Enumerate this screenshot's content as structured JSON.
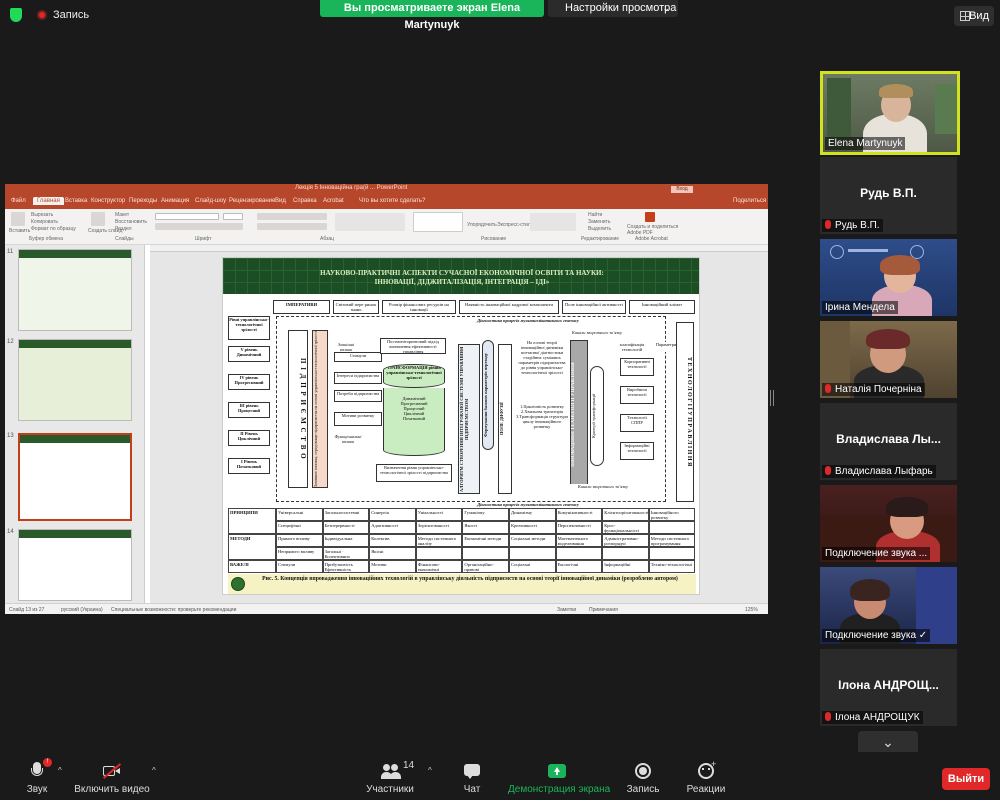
{
  "topbar": {
    "record_label": "Запись",
    "share_banner": "Вы просматриваете экран Elena Martynuyk",
    "view_settings": "Настройки просмотра",
    "view_button": "Вид"
  },
  "ppt": {
    "window_title": "Лекція 5 Інноваційна гра(й ... PowerPoint",
    "sign_in": "Вход",
    "tabs": [
      "Файл",
      "Главная",
      "Вставка",
      "Конструктор",
      "Переходы",
      "Анимация",
      "Слайд-шоу",
      "Рецензирование",
      "Вид",
      "Справка",
      "Acrobat"
    ],
    "tell_me": "Что вы хотите сделать?",
    "share": "Поделиться",
    "groups": [
      "Буфер обмена",
      "Слайды",
      "Шрифт",
      "Абзац",
      "Рисование",
      "Редактирование",
      "Adobe Acrobat"
    ],
    "ribbon_items": [
      "Вставить",
      "Вырезать",
      "Копировать",
      "Формат по образцу",
      "Создать слайд",
      "Макет",
      "Восстановить",
      "Раздел",
      "Упорядочить",
      "Экспресс-стили",
      "Найти",
      "Заменить",
      "Выделить",
      "Создать и поделиться Adobe PDF"
    ],
    "thumb_numbers": [
      "11",
      "12",
      "13",
      "14"
    ],
    "status": {
      "slide": "Слайд 13 из 27",
      "lang": "русский (Украина)",
      "accessibility": "Специальные возможности: проверьте рекомендации",
      "notes": "Заметки",
      "comments": "Примечания",
      "zoom": "125%"
    }
  },
  "slide": {
    "title_line1": "НАУКОВО-ПРАКТИЧНІ АСПЕКТИ СУЧАСНОЇ ЕКОНОМІЧНОЇ ОСВІТИ ТА НАУКИ:",
    "title_line2": "ІННОВАЦІЇ, ДІДЖИТАЛІЗАЦІЯ, ІНТЕГРАЦІЯ – ІДІ»",
    "imperatives": [
      "ІМПЕРАТИВИ",
      "Світовий пере ринок знань",
      "Розмір фінансових ресурсів на інновації",
      "Наявність інноваційної кадрової компоненти",
      "Поле інноваційної активності",
      "Інноваційний клімат"
    ],
    "levels": [
      "Рівні управлінсько-технологічної зрілості",
      "V рівень Динамічний",
      "IV рівень Прогресивний",
      "III рівень Процесний",
      "II Рівень Циклічний",
      "I Рівень Початковий"
    ],
    "enterprise": "П І Д П Р И Є М С Т В О",
    "environment_left": "Зовнішнє інновац. середовище підприємства на основі управлінсько-технологічної зрілості",
    "diag_top": "Діагностика процесів мультиплікативного генезису",
    "diag_bottom": "Діагностика процесів мультиплікативного генезису",
    "feedback_top": "Канали зворотного зв’язку",
    "feedback_bottom": "Канали зворотного зв’язку",
    "transformation": "ТРАНСФОРМАЦІЯ рівнів управлінсько-технологічної зрілості",
    "cylinder_items": [
      "Динамічний",
      "Прогресивний",
      "Процесний",
      "Циклічний",
      "Початковий"
    ],
    "stimuli": "Стимули",
    "interests": "Інтереси підприємства",
    "needs": "Потреби підприємства",
    "motives": "Мотиви розвитку",
    "external_label": "Зовнішні впливи",
    "functional_label": "Функціональні впливи",
    "postmonitoring": "Постмоніторинговий підхід визначення ефективності управління",
    "defining": "Визначення рівня управлінсько-технологічної зрілості підприємства",
    "algorithm": "АЛГОРИТМ СТВОРЕННЯ ІНТЕГРОВАНОЇ СИСТЕМИ УПРАВЛІННЯ ПІДПРИЄМСТВОМ",
    "formation": "Формування базових параметрів переходу",
    "diffusion": "ПОЛЕ ДИФУЗІЇ",
    "theory": "На основі теорії інноваційної динаміки поетапної діагностики стадійних суміжних параметрів підприємства до рівня управлінсько-технологічної зрілості",
    "steps": "1.Циклічність розвитку 2.Хвильова траєкторія 3.Трансформація структури циклу інноваційного розвитку",
    "innovation_tech": "ІННОВАЦІЙНІ ТЕХНОЛОГІЇ УПРАВЛІННЯ",
    "classification": "класифікація технологій",
    "parameter": "Параметри",
    "criteria": "Критерії трансформації",
    "tech_list": [
      "Корпоративні технології",
      "Виробничі технології",
      "Технології СППР",
      "Інформаційні технології"
    ],
    "tech_right": "Т Е Х Н О Л О Г І Ї   У П Р А В Л І Н Н Я",
    "table": {
      "rows": [
        {
          "label": "ПРИНЦИПИ",
          "cells": [
            "Універсальні",
            "Загальносистемні",
            "Синергія",
            "Унікальності",
            "Гуманізму",
            "Динамізму",
            "Комунікативності",
            "Клієнтоорієнтованості",
            "Інноваційного розвитку"
          ]
        },
        {
          "label": "",
          "cells": [
            "Специфічні",
            "Безперервності",
            "Адаптивності",
            "Зорієнтованості",
            "Якості",
            "Креативності",
            "Перспективності",
            "Крос-функціональності",
            ""
          ]
        },
        {
          "label": "МЕТОДИ",
          "cells": [
            "Прямого впливу",
            "Індивідуальна",
            "Колектив",
            "Методи системного аналізу",
            "Економічні методи",
            "Соціальні методи",
            "Математичного моделювання",
            "Адміністративно-розпорядчі",
            "Методи системного програмування"
          ]
        },
        {
          "label": "",
          "cells": [
            "Непрямого впливу",
            "Загальні · Колективних",
            "Якісні",
            "",
            "",
            "",
            "",
            "",
            ""
          ]
        },
        {
          "label": "ВАЖЕЛІ",
          "cells": [
            "Стимули",
            "Прибутковість Ефективність",
            "Мотиви",
            "Фінансово-економічні",
            "Організаційно-правові",
            "Соціальні",
            "Екологічні",
            "Інформаційні",
            "Техніко-технологічні"
          ]
        }
      ]
    },
    "caption": "Рис. 5. Концепція впровадження інноваційних технологій в управлінську діяльність підприємств на основі теорії інноваційної динаміки (розроблено автором)"
  },
  "participants": [
    {
      "name": "Elena Martynuyk",
      "mic_off": false,
      "video": true,
      "active": true
    },
    {
      "name": "Рудь В.П.",
      "display": "Рудь В.П.",
      "mic_off": true,
      "video": false
    },
    {
      "name": "Ірина Мендела",
      "mic_off": false,
      "video": true
    },
    {
      "name": "Наталія Почерніна",
      "mic_off": true,
      "video": true
    },
    {
      "name": "Владислава Лыфарь",
      "display": "Владислава Лы...",
      "mic_off": true,
      "video": false
    },
    {
      "name": "Подключение звука ...",
      "mic_off": false,
      "video": true
    },
    {
      "name": "Подключение звука ✓",
      "mic_off": false,
      "video": true
    },
    {
      "name": "Ілона АНДРОЩУК",
      "display": "Ілона АНДРОЩ...",
      "mic_off": true,
      "video": false
    }
  ],
  "toolbar": {
    "audio": "Звук",
    "video": "Включить видео",
    "participants": "Участники",
    "participants_count": "14",
    "chat": "Чат",
    "share": "Демонстрация экрана",
    "record": "Запись",
    "reactions": "Реакции",
    "leave": "Выйти"
  },
  "colors": {
    "accent_green": "#1ab55a",
    "leave_red": "#e02828",
    "active_border": "#d3e21f",
    "ppt_brand": "#b7472a"
  }
}
